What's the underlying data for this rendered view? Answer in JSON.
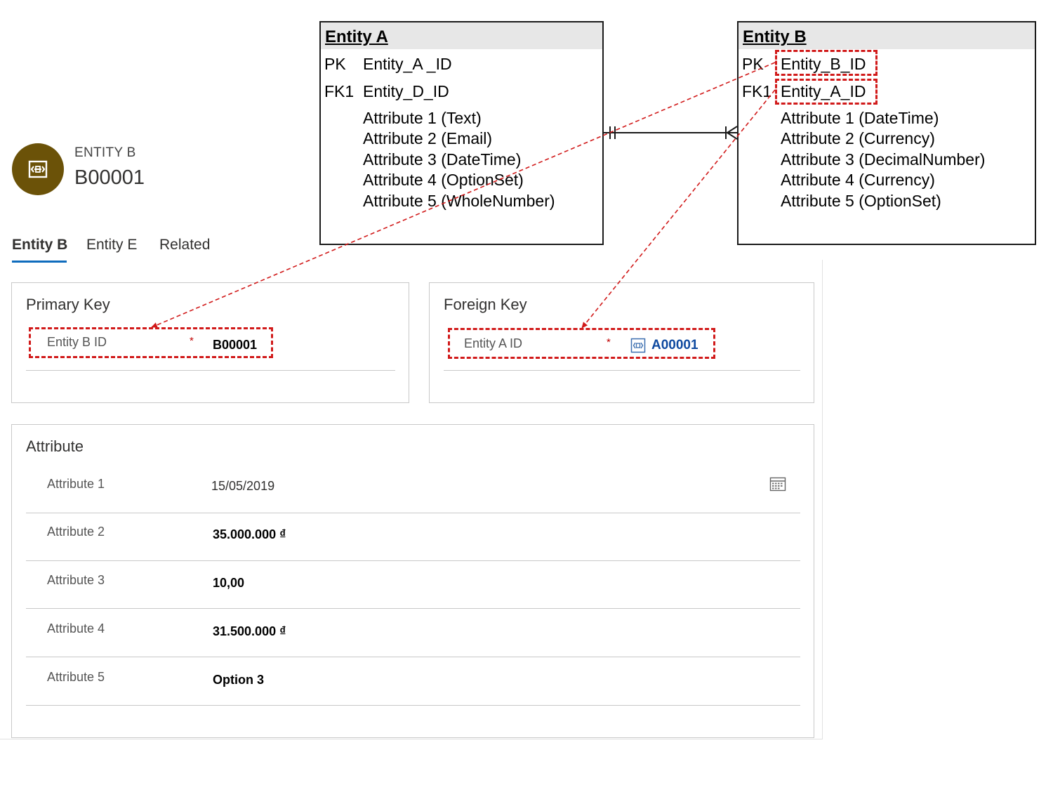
{
  "erd": {
    "entity_a": {
      "title": "Entity A",
      "pk_label": "PK",
      "pk_field": "Entity_A _ID",
      "fk_label": "FK1",
      "fk_field": "Entity_D_ID",
      "attributes": [
        "Attribute 1 (Text)",
        "Attribute 2 (Email)",
        "Attribute 3 (DateTime)",
        "Attribute 4 (OptionSet)",
        "Attribute 5 (WholeNumber)"
      ]
    },
    "entity_b": {
      "title": "Entity B",
      "pk_label": "PK",
      "pk_field": "Entity_B_ID",
      "fk_label": "FK1",
      "fk_field": "Entity_A_ID",
      "attributes": [
        "Attribute 1 (DateTime)",
        "Attribute 2 (Currency)",
        "Attribute 3 (DecimalNumber)",
        "Attribute 4 (Currency)",
        "Attribute 5 (OptionSet)"
      ]
    },
    "relationship": "one-to-many",
    "highlight_color": "#d11a1a"
  },
  "form": {
    "entity_type": "ENTITY B",
    "record_name": "B00001",
    "avatar_icon": "entity-record-icon",
    "avatar_color": "#6b5208",
    "tabs": [
      {
        "label": "Entity B",
        "active": true
      },
      {
        "label": "Entity E",
        "active": false
      },
      {
        "label": "Related",
        "active": false
      }
    ],
    "primary_key": {
      "title": "Primary Key",
      "label": "Entity B ID",
      "required_mark": "*",
      "value": "B00001"
    },
    "foreign_key": {
      "title": "Foreign Key",
      "label": "Entity A ID",
      "required_mark": "*",
      "value": "A00001",
      "icon": "entity-lookup-icon"
    },
    "attribute_section": {
      "title": "Attribute",
      "rows": [
        {
          "label": "Attribute 1",
          "value": "15/05/2019",
          "icon": "calendar-icon"
        },
        {
          "label": "Attribute 2",
          "value": "35.000.000 ₫"
        },
        {
          "label": "Attribute 3",
          "value": "10,00"
        },
        {
          "label": "Attribute 4",
          "value": "31.500.000 ₫"
        },
        {
          "label": "Attribute 5",
          "value": "Option 3"
        }
      ]
    }
  }
}
